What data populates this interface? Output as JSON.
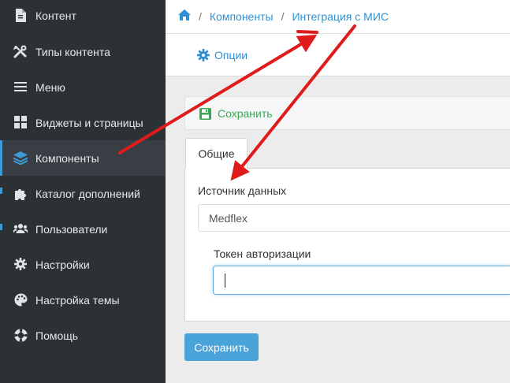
{
  "sidebar": {
    "items": [
      {
        "label": "Контент",
        "icon": "file-icon"
      },
      {
        "label": "Типы контента",
        "icon": "tools-icon"
      },
      {
        "label": "Меню",
        "icon": "menu-icon"
      },
      {
        "label": "Виджеты и страницы",
        "icon": "widgets-icon"
      },
      {
        "label": "Компоненты",
        "icon": "layers-icon",
        "active": true
      },
      {
        "label": "Каталог дополнений",
        "icon": "puzzle-icon"
      },
      {
        "label": "Пользователи",
        "icon": "users-icon"
      },
      {
        "label": "Настройки",
        "icon": "gear-icon"
      },
      {
        "label": "Настройка темы",
        "icon": "palette-icon"
      },
      {
        "label": "Помощь",
        "icon": "lifebuoy-icon"
      }
    ]
  },
  "breadcrumb": {
    "home_icon": "home-icon",
    "components": "Компоненты",
    "current": "Интеграция с МИС"
  },
  "options": {
    "label": "Опции",
    "icon": "gear-icon"
  },
  "toolbar": {
    "save_label": "Сохранить",
    "icon": "floppy-icon"
  },
  "tabs": [
    {
      "label": "Общие",
      "active": true
    }
  ],
  "form": {
    "data_source": {
      "label": "Источник данных",
      "value": "Medflex"
    },
    "auth_token": {
      "label": "Токен авторизации",
      "value": ""
    }
  },
  "submit": {
    "label": "Сохранить"
  },
  "colors": {
    "sidebar_bg": "#2c3136",
    "accent": "#3c9bd6",
    "link": "#2f8fd1",
    "save_green": "#3aa856",
    "primary_button": "#4aa3d9",
    "annotation_arrow": "#e01b1b"
  }
}
